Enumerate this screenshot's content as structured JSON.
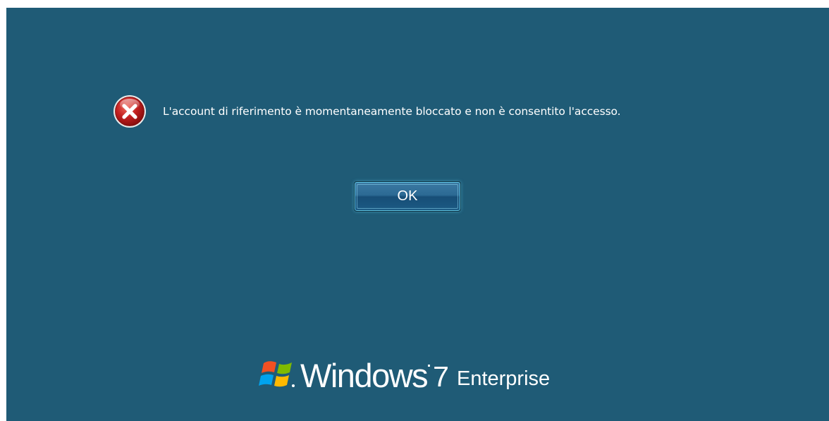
{
  "dialog": {
    "message": "L'account di riferimento è momentaneamente bloccato e non è consentito l'accesso.",
    "ok_label": "OK",
    "icon": "error-icon"
  },
  "branding": {
    "logo_icon": "windows-flag-icon",
    "name": "Windows",
    "version": "7",
    "edition": "Enterprise"
  },
  "colors": {
    "background": "#1f5b76",
    "text": "#ffffff",
    "error_icon": "#c21f1f",
    "button_glow": "#5ec6e6"
  }
}
